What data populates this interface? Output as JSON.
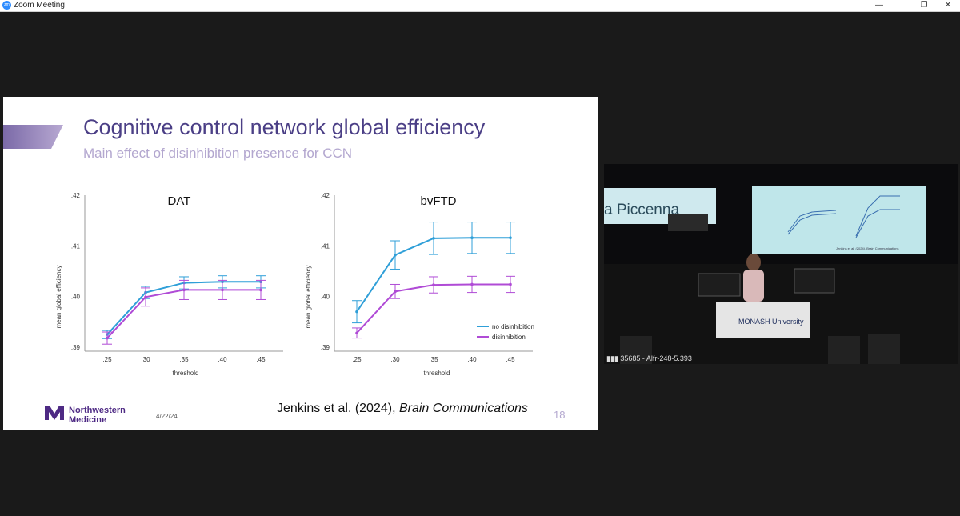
{
  "window": {
    "title": "Zoom Meeting",
    "icon": "zoom-icon",
    "minimize_icon": "minimize-icon",
    "restore_icon": "restore-icon",
    "close_icon": "close-icon"
  },
  "slide": {
    "title": "Cognitive control network global efficiency",
    "subtitle": "Main effect of disinhibition presence for CCN",
    "citation_authors": "Jenkins et al. (2024), ",
    "citation_journal": "Brain Communications",
    "page_number": "18",
    "date": "4/22/24",
    "logo": {
      "line1": "Northwestern",
      "line2": "Medicine",
      "mark": "NM"
    },
    "colors": {
      "title": "#4b3f86",
      "subtitle": "#b3a7cf",
      "no_disinhibition": "#2f9fd8",
      "disinhibition": "#b04bd6"
    }
  },
  "chart_data": [
    {
      "type": "line",
      "title": "DAT",
      "xlabel": "threshold",
      "ylabel": "mean global efficiency",
      "x": [
        ".25",
        ".30",
        ".35",
        ".40",
        ".45"
      ],
      "yticks": [
        ".39",
        ".40",
        ".41",
        ".42"
      ],
      "ylim": [
        0.39,
        0.42
      ],
      "series": [
        {
          "name": "no disinhibition",
          "values": [
            0.3925,
            0.4008,
            0.4027,
            0.4029,
            0.4029
          ],
          "err": [
            0.0008,
            0.0012,
            0.0012,
            0.0012,
            0.0012
          ]
        },
        {
          "name": "disinhibition",
          "values": [
            0.3918,
            0.3999,
            0.4013,
            0.4013,
            0.4013
          ],
          "err": [
            0.0012,
            0.0018,
            0.0019,
            0.0019,
            0.0019
          ]
        }
      ]
    },
    {
      "type": "line",
      "title": "bvFTD",
      "xlabel": "threshold",
      "ylabel": "mean global efficiency",
      "x": [
        ".25",
        ".30",
        ".35",
        ".40",
        ".45"
      ],
      "yticks": [
        ".39",
        ".40",
        ".41",
        ".42"
      ],
      "ylim": [
        0.39,
        0.42
      ],
      "legend": "bottom-right",
      "series": [
        {
          "name": "no disinhibition",
          "values": [
            0.397,
            0.4082,
            0.4115,
            0.4116,
            0.4116
          ],
          "err": [
            0.0022,
            0.0028,
            0.0032,
            0.0031,
            0.0031
          ]
        },
        {
          "name": "disinhibition",
          "values": [
            0.3928,
            0.401,
            0.4023,
            0.4024,
            0.4024
          ],
          "err": [
            0.001,
            0.0014,
            0.0016,
            0.0016,
            0.0016
          ]
        }
      ]
    }
  ],
  "video": {
    "participant_label": "35685 - Alfr-248-5.393",
    "screen_text": "a Piccenna",
    "lectern_text": "MONASH University",
    "small_citation": "Jenkins et al. (2024), Brain Communications"
  }
}
